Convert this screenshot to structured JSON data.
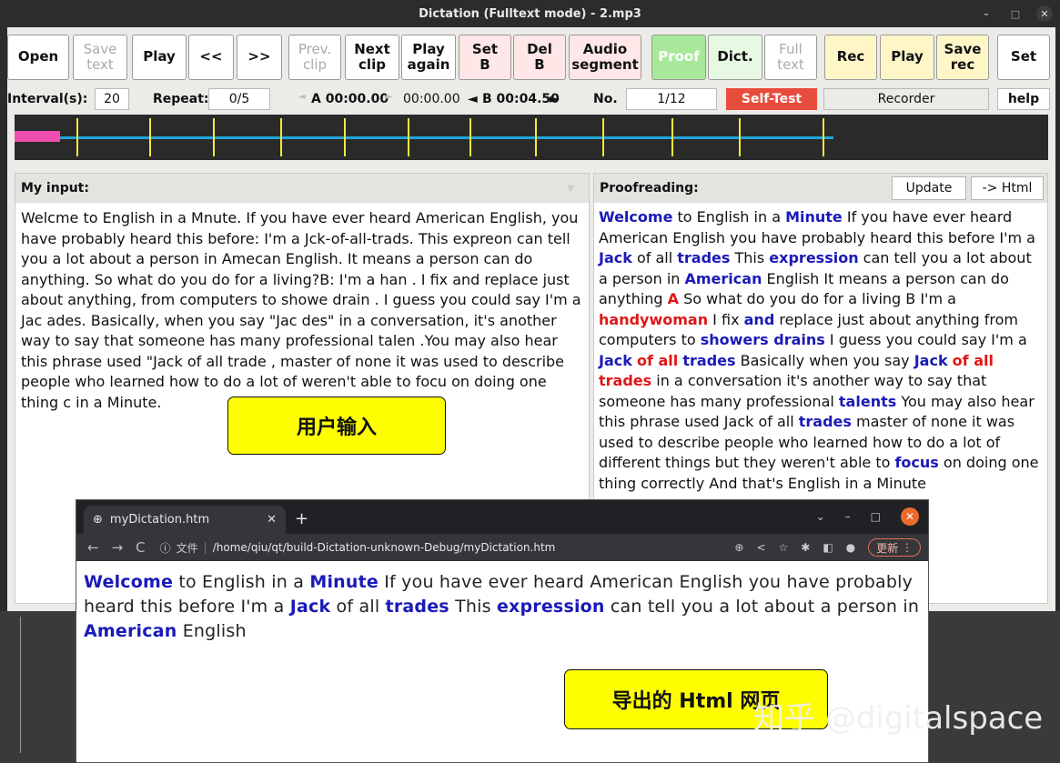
{
  "window": {
    "title": "Dictation (Fulltext mode) - 2.mp3"
  },
  "toolbar": {
    "open": "Open",
    "save_text": "Save\ntext",
    "play": "Play",
    "back": "<<",
    "forward": ">>",
    "prev_clip": "Prev.\nclip",
    "next_clip": "Next\nclip",
    "play_again": "Play\nagain",
    "set_b": "Set\nB",
    "del_b": "Del\nB",
    "audio_segment": "Audio\nsegment",
    "proof": "Proof",
    "dict": "Dict.",
    "full_text": "Full\ntext",
    "rec": "Rec",
    "rec_play": "Play",
    "save_rec": "Save\nrec",
    "set": "Set"
  },
  "infobar": {
    "interval_label": "Interval(s):",
    "interval_value": "20",
    "repeat_label": "Repeat:",
    "repeat_value": "0/5",
    "a_time": "A 00:00.00",
    "mid_time": "00:00.00",
    "b_time": "B 00:04.50",
    "no_label": "No.",
    "no_value": "1/12",
    "self_test": "Self-Test",
    "recorder": "Recorder",
    "help": "help"
  },
  "colors": {
    "self_test_bg": "#e84c3d",
    "proof_bg": "#a8e89a",
    "highlight_blue": "#1a1ab8",
    "highlight_red": "#e01616",
    "callout_bg": "#fefe00"
  },
  "input_panel": {
    "header": "My input:",
    "text": "Welcme to English in a Mnute. If you have ever heard American English, you have probably heard this before: I'm a Jck-of-all-trads. This expreon can tell you a lot about a person in Amecan English. It means a person can do anything.  So what do you do for a living?B: I'm a han . I fix and replace just about anything, from computers to showe  drain . I guess you could say I'm a Jac ades. Basically, when you say \"Jac des\" in a conversation, it's another way to say that someone has many professional talen .You may also hear this phrase used \"Jack of all trade , master of none  it was used to describe people who learned how to do a lot of                          weren't able to focu  on doing one thing c                            in a Minute."
  },
  "proof_panel": {
    "header": "Proofreading:",
    "update": "Update",
    "to_html": "-> Html"
  },
  "callouts": {
    "user_input": "用户输入",
    "exported": "导出的 Html 网页"
  },
  "browser": {
    "tab_title": "myDictation.htm",
    "url_prefix": "文件",
    "url": "/home/qiu/qt/build-Dictation-unknown-Debug/myDictation.htm",
    "update_btn": "更新"
  },
  "watermark": "知乎 @digitalspace"
}
